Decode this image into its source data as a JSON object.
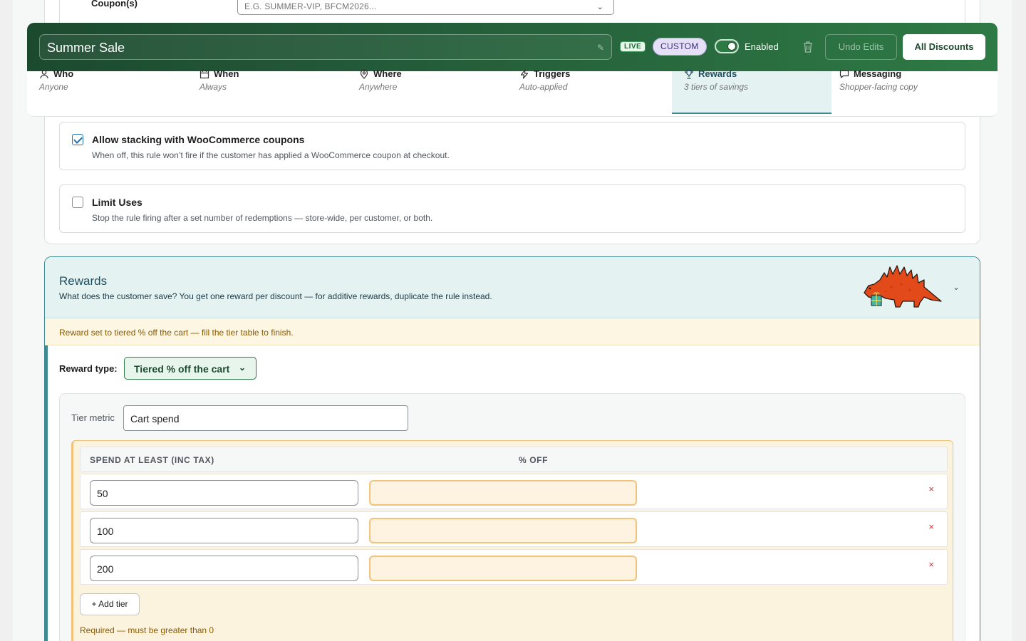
{
  "coupons": {
    "label": "Coupon(s)",
    "placeholder": "E.G. SUMMER-VIP, BFCM2026..."
  },
  "header": {
    "title": "Summer Sale",
    "live_badge": "LIVE",
    "custom_badge": "CUSTOM",
    "toggle_label": "Enabled",
    "toggle_on": true,
    "undo_label": "Undo Edits",
    "all_discounts_label": "All Discounts"
  },
  "tabs": [
    {
      "label": "Who",
      "sub": "Anyone",
      "icon": "person-icon"
    },
    {
      "label": "When",
      "sub": "Always",
      "icon": "calendar-icon"
    },
    {
      "label": "Where",
      "sub": "Anywhere",
      "icon": "location-pin-icon"
    },
    {
      "label": "Triggers",
      "sub": "Auto-applied",
      "icon": "lightning-icon"
    },
    {
      "label": "Rewards",
      "sub": "3 tiers of savings",
      "icon": "trophy-icon",
      "active": true
    },
    {
      "label": "Messaging",
      "sub": "Shopper-facing copy",
      "icon": "chat-bubble-icon"
    }
  ],
  "options": {
    "stacking": {
      "title": "Allow stacking with WooCommerce coupons",
      "desc": "When off, this rule won’t fire if the customer has applied a WooCommerce coupon at checkout.",
      "checked": true
    },
    "limit": {
      "title": "Limit Uses",
      "desc": "Stop the rule firing after a set number of redemptions — store-wide, per customer, or both.",
      "checked": false
    }
  },
  "rewards": {
    "title": "Rewards",
    "desc": "What does the customer save? You get one reward per discount — for additive rewards, duplicate the rule instead.",
    "notice": "Reward set to tiered % off the cart — fill the tier table to finish.",
    "reward_type_label": "Reward type:",
    "reward_type_value": "Tiered % off the cart",
    "tier_metric_label": "Tier metric",
    "tier_metric_value": "Cart spend",
    "col_spend": "SPEND AT LEAST (INC TAX)",
    "col_pct": "% OFF",
    "tiers": [
      {
        "spend": "50",
        "pct": ""
      },
      {
        "spend": "100",
        "pct": ""
      },
      {
        "spend": "200",
        "pct": ""
      }
    ],
    "remove_symbol": "×",
    "add_tier_label": "+ Add tier",
    "required_msg": "Required — must be greater than 0"
  },
  "colors": {
    "header_green": "#245c39",
    "accent_teal": "#3d8a92",
    "warning_amber": "#f0c27a"
  }
}
